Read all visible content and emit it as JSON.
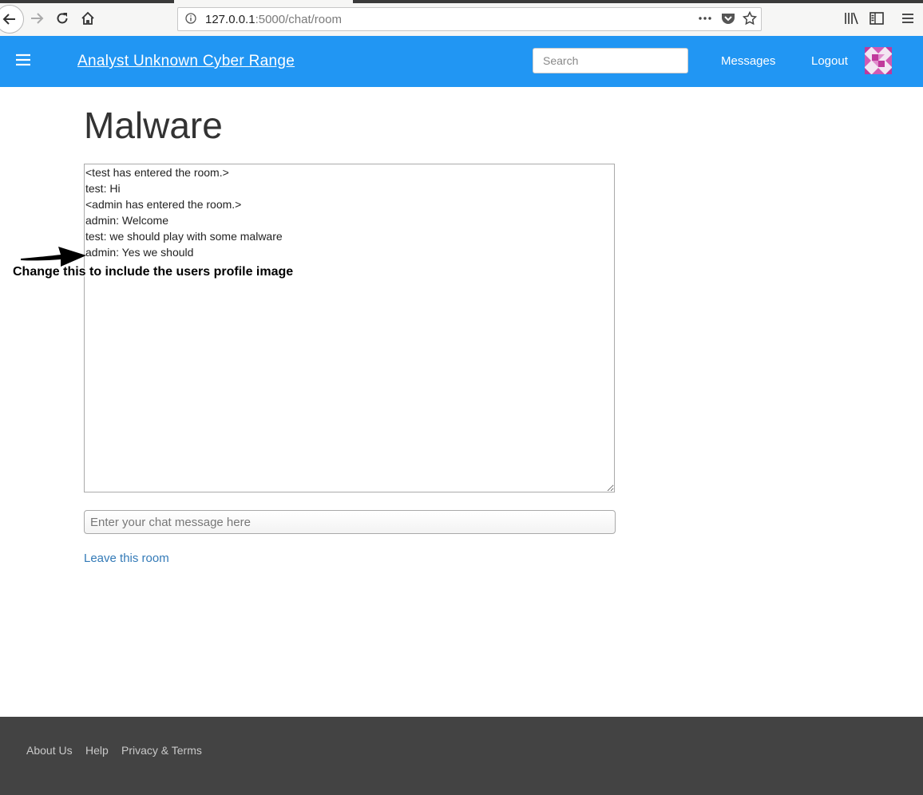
{
  "browser": {
    "url_host": "127.0.0.1",
    "url_rest": ":5000/chat/room",
    "icons": [
      "back-arrow-icon",
      "forward-arrow-icon",
      "reload-icon",
      "home-icon",
      "info-icon",
      "more-dots-icon",
      "pocket-icon",
      "bookmark-star-icon",
      "library-icon",
      "sidebar-icon",
      "hamburger-menu-icon"
    ]
  },
  "navbar": {
    "brand": "Analyst Unknown Cyber Range",
    "search_placeholder": "Search",
    "messages_label": "Messages",
    "logout_label": "Logout",
    "accent_color": "#2196f3"
  },
  "page": {
    "title": "Malware",
    "chat_log": "<test has entered the room.>\ntest: Hi\n<admin has entered the room.>\nadmin: Welcome\ntest: we should play with some malware\nadmin: Yes we should",
    "chat_input_placeholder": "Enter your chat message here",
    "leave_label": "Leave this room"
  },
  "annotation": {
    "text": "Change this to include the users profile image"
  },
  "footer": {
    "links": [
      "About Us",
      "Help",
      "Privacy & Terms"
    ],
    "bg_color": "#434343"
  }
}
